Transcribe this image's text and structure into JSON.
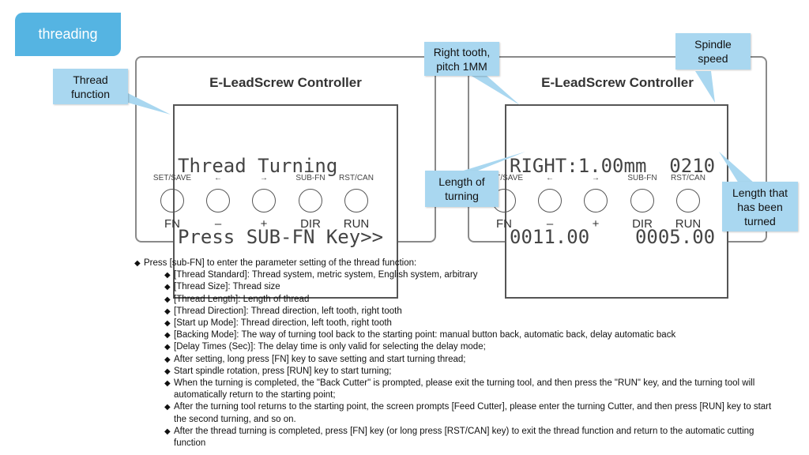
{
  "badge": {
    "label": "threading"
  },
  "callouts": {
    "thread_function": "Thread function",
    "right_tooth": "Right tooth, pitch 1MM",
    "spindle_speed": "Spindle speed",
    "length_of_turning": "Length of turning",
    "length_turned": "Length that has been turned"
  },
  "panels": [
    {
      "title": "E-LeadScrew Controller",
      "lcd": [
        "Thread Turning",
        "Press SUB-FN Key>>"
      ]
    },
    {
      "title": "E-LeadScrew Controller",
      "lcd": [
        "RIGHT:1.00mm  0210",
        "0011.00    0005.00"
      ]
    }
  ],
  "keys": [
    {
      "top": "SET/SAVE",
      "bottom": "FN"
    },
    {
      "top": "←",
      "bottom": "–"
    },
    {
      "top": "→",
      "bottom": "+"
    },
    {
      "top": "SUB-FN",
      "bottom": "DIR"
    },
    {
      "top": "RST/CAN",
      "bottom": "RUN"
    }
  ],
  "notes": [
    {
      "level": 0,
      "text": "Press [sub-FN] to enter the parameter setting of the thread function:"
    },
    {
      "level": 1,
      "text": "[Thread Standard]:  Thread system, metric system, English system, arbitrary"
    },
    {
      "level": 1,
      "text": "[Thread Size]:  Thread size"
    },
    {
      "level": 1,
      "text": "[Thread Length]:  Length of thread"
    },
    {
      "level": 1,
      "text": "[Thread Direction]:  Thread direction, left tooth, right tooth"
    },
    {
      "level": 1,
      "text": "[Start up Mode]:  Thread direction, left tooth, right tooth"
    },
    {
      "level": 1,
      "text": "[Backing Mode]:  The way of turning tool back to the starting point: manual button back, automatic back, delay automatic back"
    },
    {
      "level": 1,
      "text": "[Delay Times (Sec)]:  The delay time is only valid for selecting the delay mode;"
    },
    {
      "level": 1,
      "text": "After setting, long press [FN] key to save setting and start turning thread;"
    },
    {
      "level": 1,
      "text": "Start spindle rotation, press [RUN] key to start turning;"
    },
    {
      "level": 1,
      "text": "When the turning is completed, the \"Back Cutter\" is prompted, please exit the turning tool, and then press the \"RUN\" key, and the turning tool will automatically return to the starting point;"
    },
    {
      "level": 1,
      "text": "After the turning tool returns to the starting point, the screen prompts [Feed Cutter], please enter the turning Cutter, and then press [RUN] key to start the second turning, and so on."
    },
    {
      "level": 1,
      "text": "After the thread turning is completed, press [FN] key (or long press [RST/CAN] key) to exit the thread function and return to the automatic cutting function"
    }
  ]
}
